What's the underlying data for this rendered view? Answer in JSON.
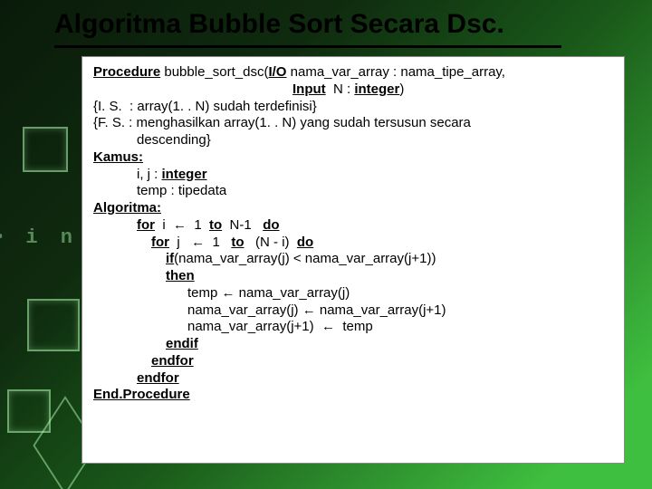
{
  "title": "Algoritma Bubble Sort Secara Dsc.",
  "sig": {
    "proc_kw": "Procedure",
    "proc_name": " bubble_sort_dsc(",
    "io_kw": "I/O",
    "io_rest": " nama_var_array : nama_tipe_array,",
    "input_kw": "Input",
    "input_rest": "  N : ",
    "int_kw": "integer",
    "input_close": ")"
  },
  "pre": {
    "is": "{I. S.  : array(1. . N) sudah terdefinisi}",
    "fs1": "{F. S. : menghasilkan array(1. . N) yang sudah tersusun secara",
    "fs2": "descending}"
  },
  "kamus": {
    "head": "Kamus:",
    "l1a": "i, j : ",
    "l1b": "integer",
    "l2": "temp : tipedata"
  },
  "algo": {
    "head": "Algoritma:",
    "for1": {
      "for": "for",
      "mid": "  i  ←  1  ",
      "to": "to",
      "end": "  N-1   ",
      "do": "do"
    },
    "for2": {
      "for": "for",
      "mid": "  j   ←  1   ",
      "to": "to",
      "end": "   (N - i)  ",
      "do": "do"
    },
    "if_kw": "if",
    "if_cond": "(nama_var_array(j) < nama_var_array(j+1))",
    "then": "then",
    "s1": "temp ← nama_var_array(j)",
    "s2": "nama_var_array(j) ← nama_var_array(j+1)",
    "s3": "nama_var_array(j+1)  ←  temp",
    "endif": "endif",
    "endfor1": "endfor",
    "endfor2": "endfor",
    "endproc": "End.Procedure"
  }
}
